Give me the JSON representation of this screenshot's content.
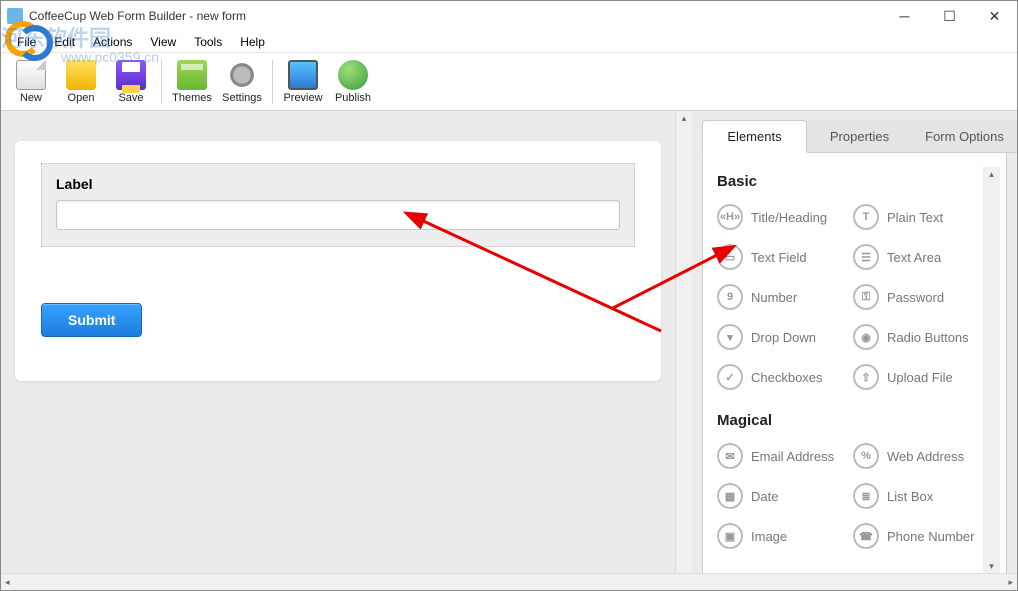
{
  "window": {
    "title": "CoffeeCup Web Form Builder - new form"
  },
  "watermark": {
    "text": "河东软件园",
    "url": "www.pc0359.cn"
  },
  "menu": {
    "file": "File",
    "edit": "Edit",
    "actions": "Actions",
    "view": "View",
    "tools": "Tools",
    "help": "Help"
  },
  "toolbar": {
    "new": "New",
    "open": "Open",
    "save": "Save",
    "themes": "Themes",
    "settings": "Settings",
    "preview": "Preview",
    "publish": "Publish"
  },
  "form": {
    "field_label": "Label",
    "input_value": "",
    "submit": "Submit"
  },
  "tabs": {
    "elements": "Elements",
    "properties": "Properties",
    "form_options": "Form Options"
  },
  "sections": {
    "basic": {
      "title": "Basic",
      "title_heading": "Title/Heading",
      "plain_text": "Plain Text",
      "text_field": "Text Field",
      "text_area": "Text Area",
      "number": "Number",
      "password": "Password",
      "drop_down": "Drop Down",
      "radio_buttons": "Radio Buttons",
      "checkboxes": "Checkboxes",
      "upload_file": "Upload File"
    },
    "magical": {
      "title": "Magical",
      "email": "Email Address",
      "web": "Web Address",
      "date": "Date",
      "list_box": "List Box",
      "image": "Image",
      "phone": "Phone Number"
    }
  },
  "icons": {
    "title_heading": "«H»",
    "plain_text": "T",
    "text_field": "▭",
    "text_area": "☰",
    "number": "9",
    "password": "⚿",
    "drop_down": "▾",
    "radio_buttons": "◉",
    "checkboxes": "✓",
    "upload_file": "⇧",
    "email": "✉",
    "web": "%",
    "date": "▦",
    "list_box": "≣",
    "image": "▣",
    "phone": "☎"
  }
}
